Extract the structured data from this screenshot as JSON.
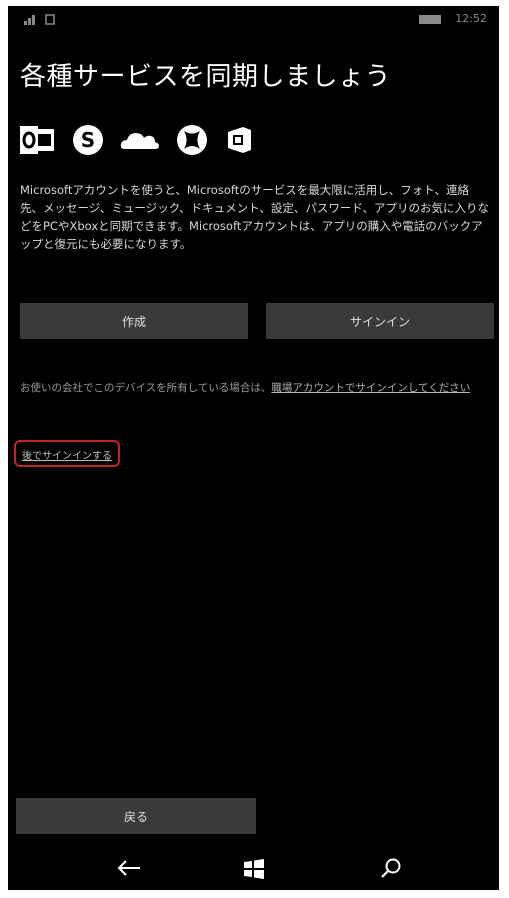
{
  "status_bar": {
    "time": "12:52",
    "signal_icon": "signal-icon",
    "battery_icon": "battery-icon"
  },
  "title": "各種サービスを同期しましょう",
  "service_icons": [
    "outlook-icon",
    "skype-icon",
    "onedrive-icon",
    "xbox-icon",
    "office-icon"
  ],
  "description": "Microsoftアカウントを使うと、Microsoftのサービスを最大限に活用し、フォト、連絡先、メッセージ、ミュージック、ドキュメント、設定、パスワード、アプリのお気に入りなどをPCやXboxと同期できます。Microsoftアカウントは、アプリの購入や電話のバックアップと復元にも必要になります。",
  "buttons": {
    "create": "作成",
    "signin": "サインイン"
  },
  "note": {
    "text": "お使いの会社でこのデバイスを所有している場合は、",
    "link": "職場アカウントでサインインしてください"
  },
  "skip_link": "後でサインインする",
  "back_button": "戻る",
  "nav": {
    "back_icon": "back-arrow-icon",
    "start_icon": "windows-start-icon",
    "search_icon": "search-icon"
  },
  "colors": {
    "background": "#000000",
    "button": "#3a3a3a",
    "highlight_border": "#c0232a"
  }
}
